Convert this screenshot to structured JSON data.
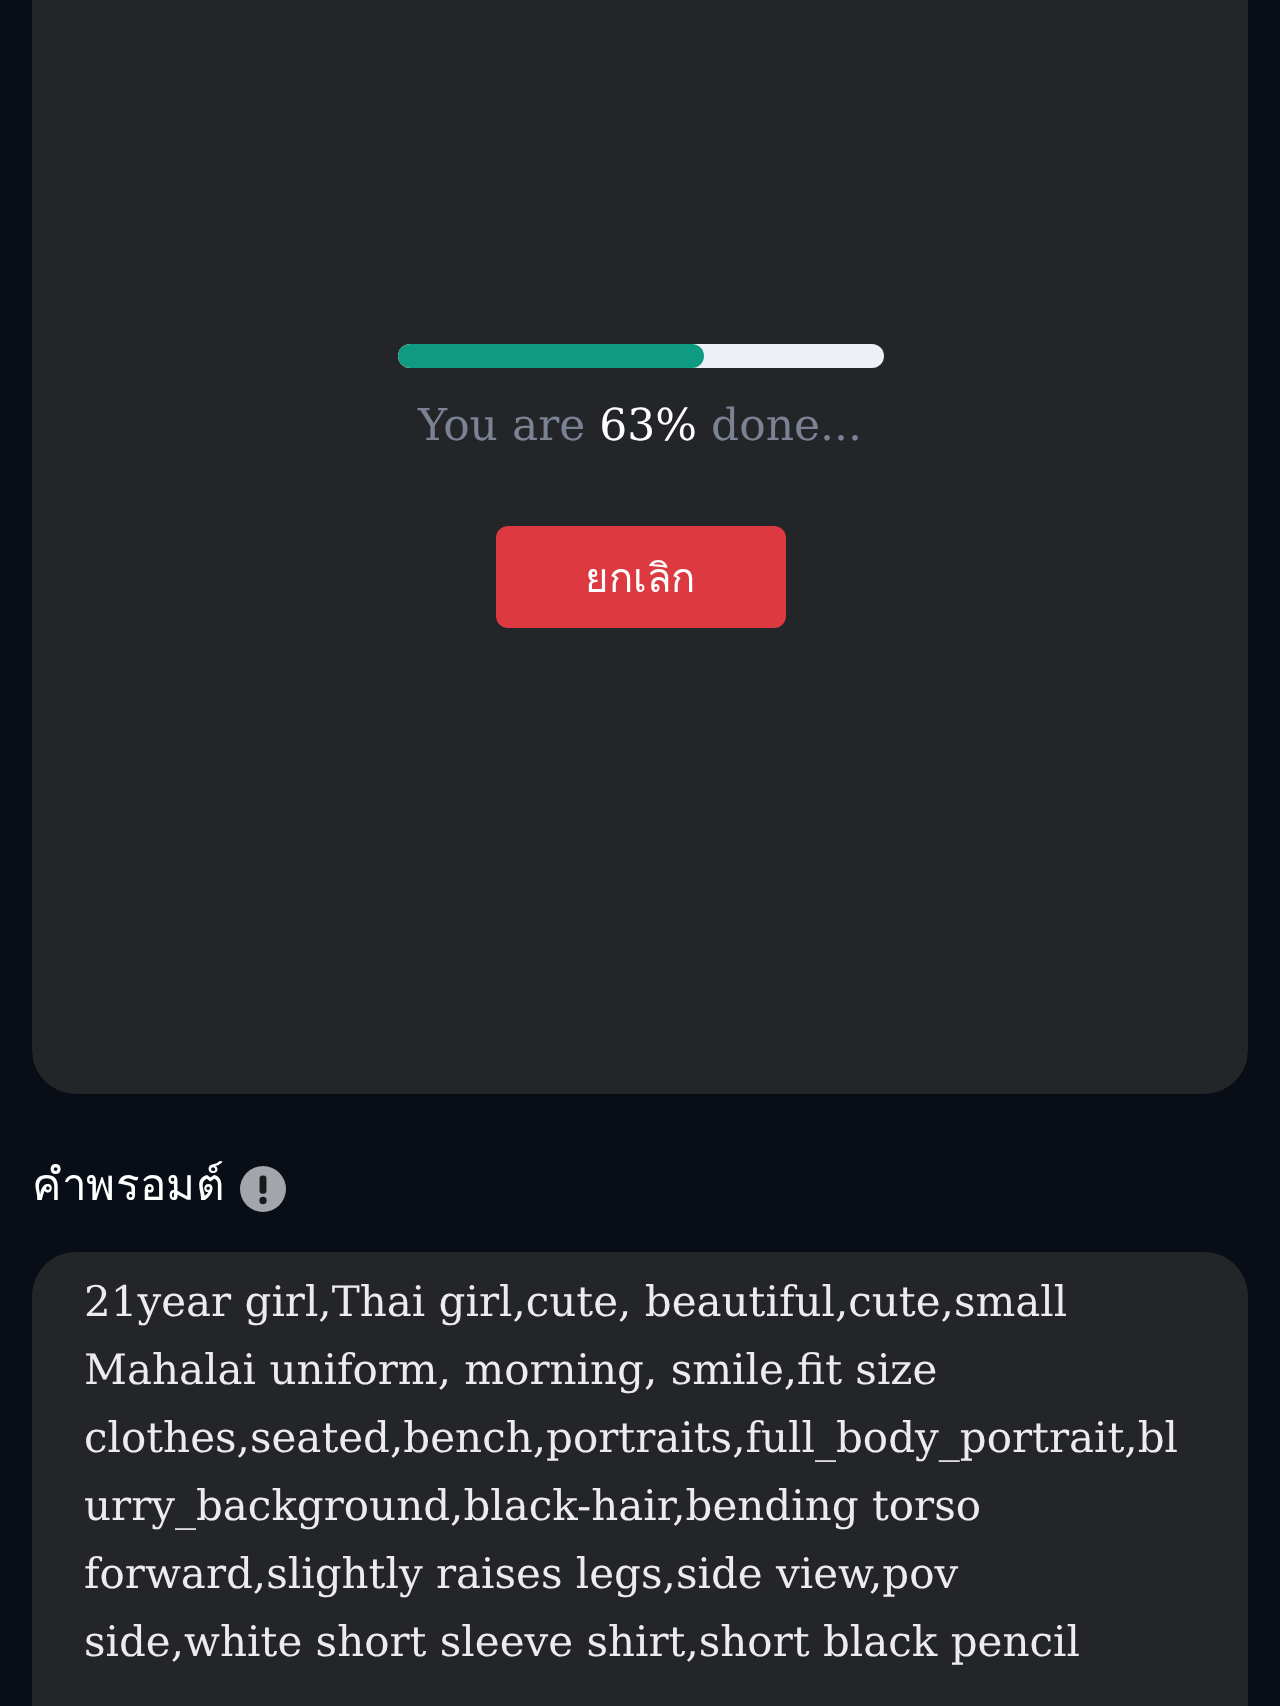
{
  "progress": {
    "level": 0.63,
    "status": "You are **63%** done...",
    "cancel_button": "ยกเลิก"
  },
  "prompt": {
    "label": "คำพรอมต์",
    "value_lines": [
      "21year girl,Thai girl,cute, beautiful,cute,small",
      "Mahalai uniform, morning, smile,fit size",
      "clothes,seated,bench,portraits,full_body_portrait,bl",
      "urry_background,black-hair,bending torso",
      "forward,slightly raises legs,side view,pov",
      "side,white short sleeve shirt,short black pencil"
    ]
  }
}
